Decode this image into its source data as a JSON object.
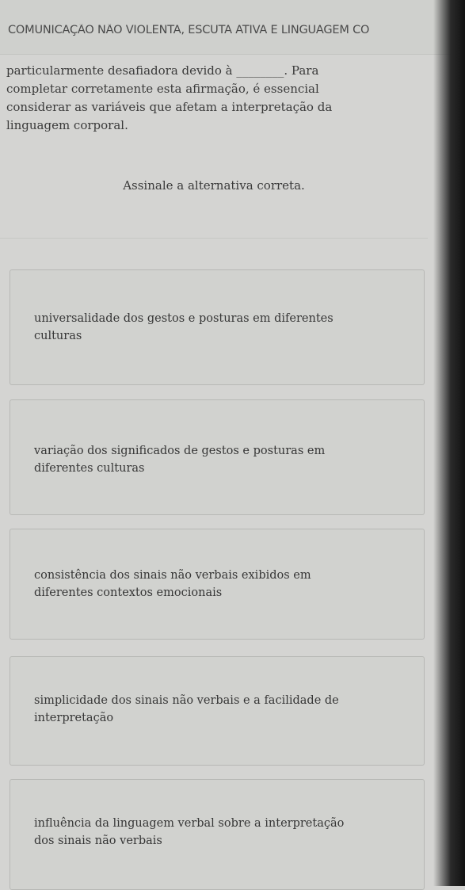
{
  "header": {
    "title": "COMUNICAÇÃO NÃO VIOLENTA, ESCUTA ATIVA E LINGUAGEM CO"
  },
  "question": {
    "line1": "particularmente desafiadora devido à ________. Para",
    "line2": "completar corretamente esta afirmação, é essencial",
    "line3": "considerar as variáveis que afetam a interpretação da",
    "line4": "linguagem corporal."
  },
  "instruction": "Assinale a alternativa correta.",
  "options": [
    {
      "line1": "universalidade dos gestos e posturas em diferentes",
      "line2": "culturas"
    },
    {
      "line1": "variação dos significados de gestos e posturas em",
      "line2": "diferentes culturas"
    },
    {
      "line1": "consistência dos sinais não verbais exibidos em",
      "line2": "diferentes contextos emocionais"
    },
    {
      "line1": "simplicidade dos sinais não verbais e a facilidade de",
      "line2": "interpretação"
    },
    {
      "line1": "influência da linguagem verbal sobre a interpretação",
      "line2": "dos sinais não verbais"
    }
  ]
}
